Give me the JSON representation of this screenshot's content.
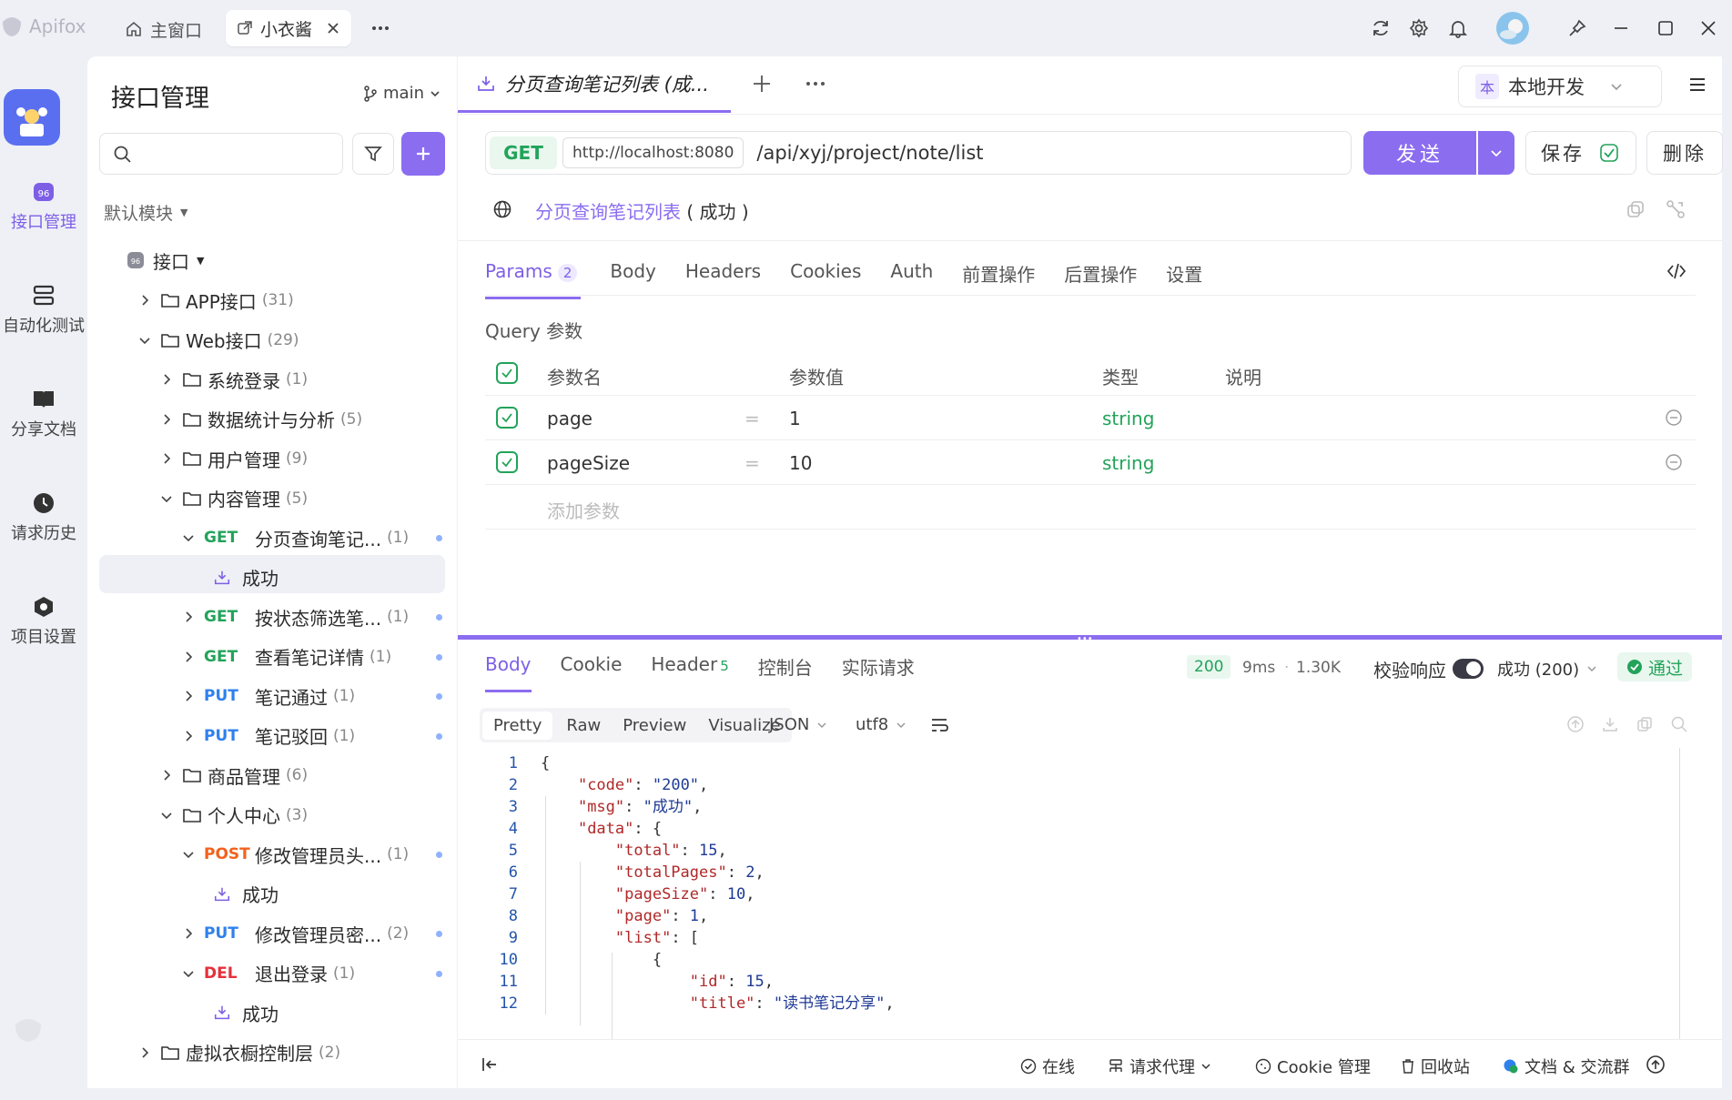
{
  "app": {
    "name": "Apifox",
    "main_tab": "主窗口",
    "project_tab": "小衣酱"
  },
  "nav": [
    {
      "label": "接口管理",
      "icon": "api-management-icon"
    },
    {
      "label": "自动化测试",
      "icon": "automation-test-icon"
    },
    {
      "label": "分享文档",
      "icon": "share-docs-icon"
    },
    {
      "label": "请求历史",
      "icon": "history-icon"
    },
    {
      "label": "项目设置",
      "icon": "project-settings-icon"
    }
  ],
  "sidebar": {
    "title": "接口管理",
    "branch": "main",
    "module": "默认模块",
    "root": "接口",
    "tree": [
      {
        "kind": "folder",
        "label": "APP接口",
        "count": "(31)"
      },
      {
        "kind": "folder",
        "label": "Web接口",
        "count": "(29)"
      },
      {
        "kind": "folder",
        "label": "系统登录",
        "count": "(1)"
      },
      {
        "kind": "folder",
        "label": "数据统计与分析",
        "count": "(5)"
      },
      {
        "kind": "folder",
        "label": "用户管理",
        "count": "(9)"
      },
      {
        "kind": "folder",
        "label": "内容管理",
        "count": "(5)"
      },
      {
        "kind": "api",
        "method": "GET",
        "label": "分页查询笔记...",
        "count": "(1)"
      },
      {
        "kind": "case",
        "label": "成功"
      },
      {
        "kind": "api",
        "method": "GET",
        "label": "按状态筛选笔...",
        "count": "(1)"
      },
      {
        "kind": "api",
        "method": "GET",
        "label": "查看笔记详情",
        "count": "(1)"
      },
      {
        "kind": "api",
        "method": "PUT",
        "label": "笔记通过",
        "count": "(1)"
      },
      {
        "kind": "api",
        "method": "PUT",
        "label": "笔记驳回",
        "count": "(1)"
      },
      {
        "kind": "folder",
        "label": "商品管理",
        "count": "(6)"
      },
      {
        "kind": "folder",
        "label": "个人中心",
        "count": "(3)"
      },
      {
        "kind": "api",
        "method": "POST",
        "label": "修改管理员头...",
        "count": "(1)"
      },
      {
        "kind": "case",
        "label": "成功"
      },
      {
        "kind": "api",
        "method": "PUT",
        "label": "修改管理员密...",
        "count": "(2)"
      },
      {
        "kind": "api",
        "method": "DEL",
        "label": "退出登录",
        "count": "(1)"
      },
      {
        "kind": "case",
        "label": "成功"
      },
      {
        "kind": "folder",
        "label": "虚拟衣橱控制层",
        "count": "(2)"
      }
    ]
  },
  "request": {
    "tab_title": "分页查询笔记列表 (成...",
    "env": "本地开发",
    "env_badge": "本",
    "method": "GET",
    "base_url": "http://localhost:8080",
    "path": "/api/xyj/project/note/list",
    "send": "发送",
    "save": "保存",
    "delete": "删除",
    "name": "分页查询笔记列表",
    "name_status": "( 成功 )",
    "tabs": [
      "Body",
      "Headers",
      "Cookies",
      "Auth",
      "前置操作",
      "后置操作",
      "设置"
    ],
    "params_tab": "Params",
    "params_count": "2",
    "query_label": "Query 参数",
    "columns": [
      "参数名",
      "参数值",
      "类型",
      "说明"
    ],
    "params": [
      {
        "name": "page",
        "value": "1",
        "type": "string"
      },
      {
        "name": "pageSize",
        "value": "10",
        "type": "string"
      }
    ],
    "add_param": "添加参数"
  },
  "response": {
    "tabs": [
      "Body",
      "Cookie",
      "Header",
      "控制台",
      "实际请求"
    ],
    "header_count": "5",
    "status": "200",
    "time": "9ms",
    "size": "1.30K",
    "validate_label": "校验响应",
    "validate_result": "成功 (200)",
    "pass": "通过",
    "formats": [
      "Pretty",
      "Raw",
      "Preview",
      "Visualize"
    ],
    "lang": "JSON",
    "encoding": "utf8",
    "code_lines": [
      "{",
      "    \"code\": \"200\",",
      "    \"msg\": \"成功\",",
      "    \"data\": {",
      "        \"total\": 15,",
      "        \"totalPages\": 2,",
      "        \"pageSize\": 10,",
      "        \"page\": 1,",
      "        \"list\": [",
      "            {",
      "                \"id\": 15,",
      "                \"title\": \"读书笔记分享\","
    ]
  },
  "statusbar": {
    "online": "在线",
    "proxy": "请求代理",
    "cookie": "Cookie 管理",
    "recycle": "回收站",
    "docs": "文档 & 交流群"
  }
}
